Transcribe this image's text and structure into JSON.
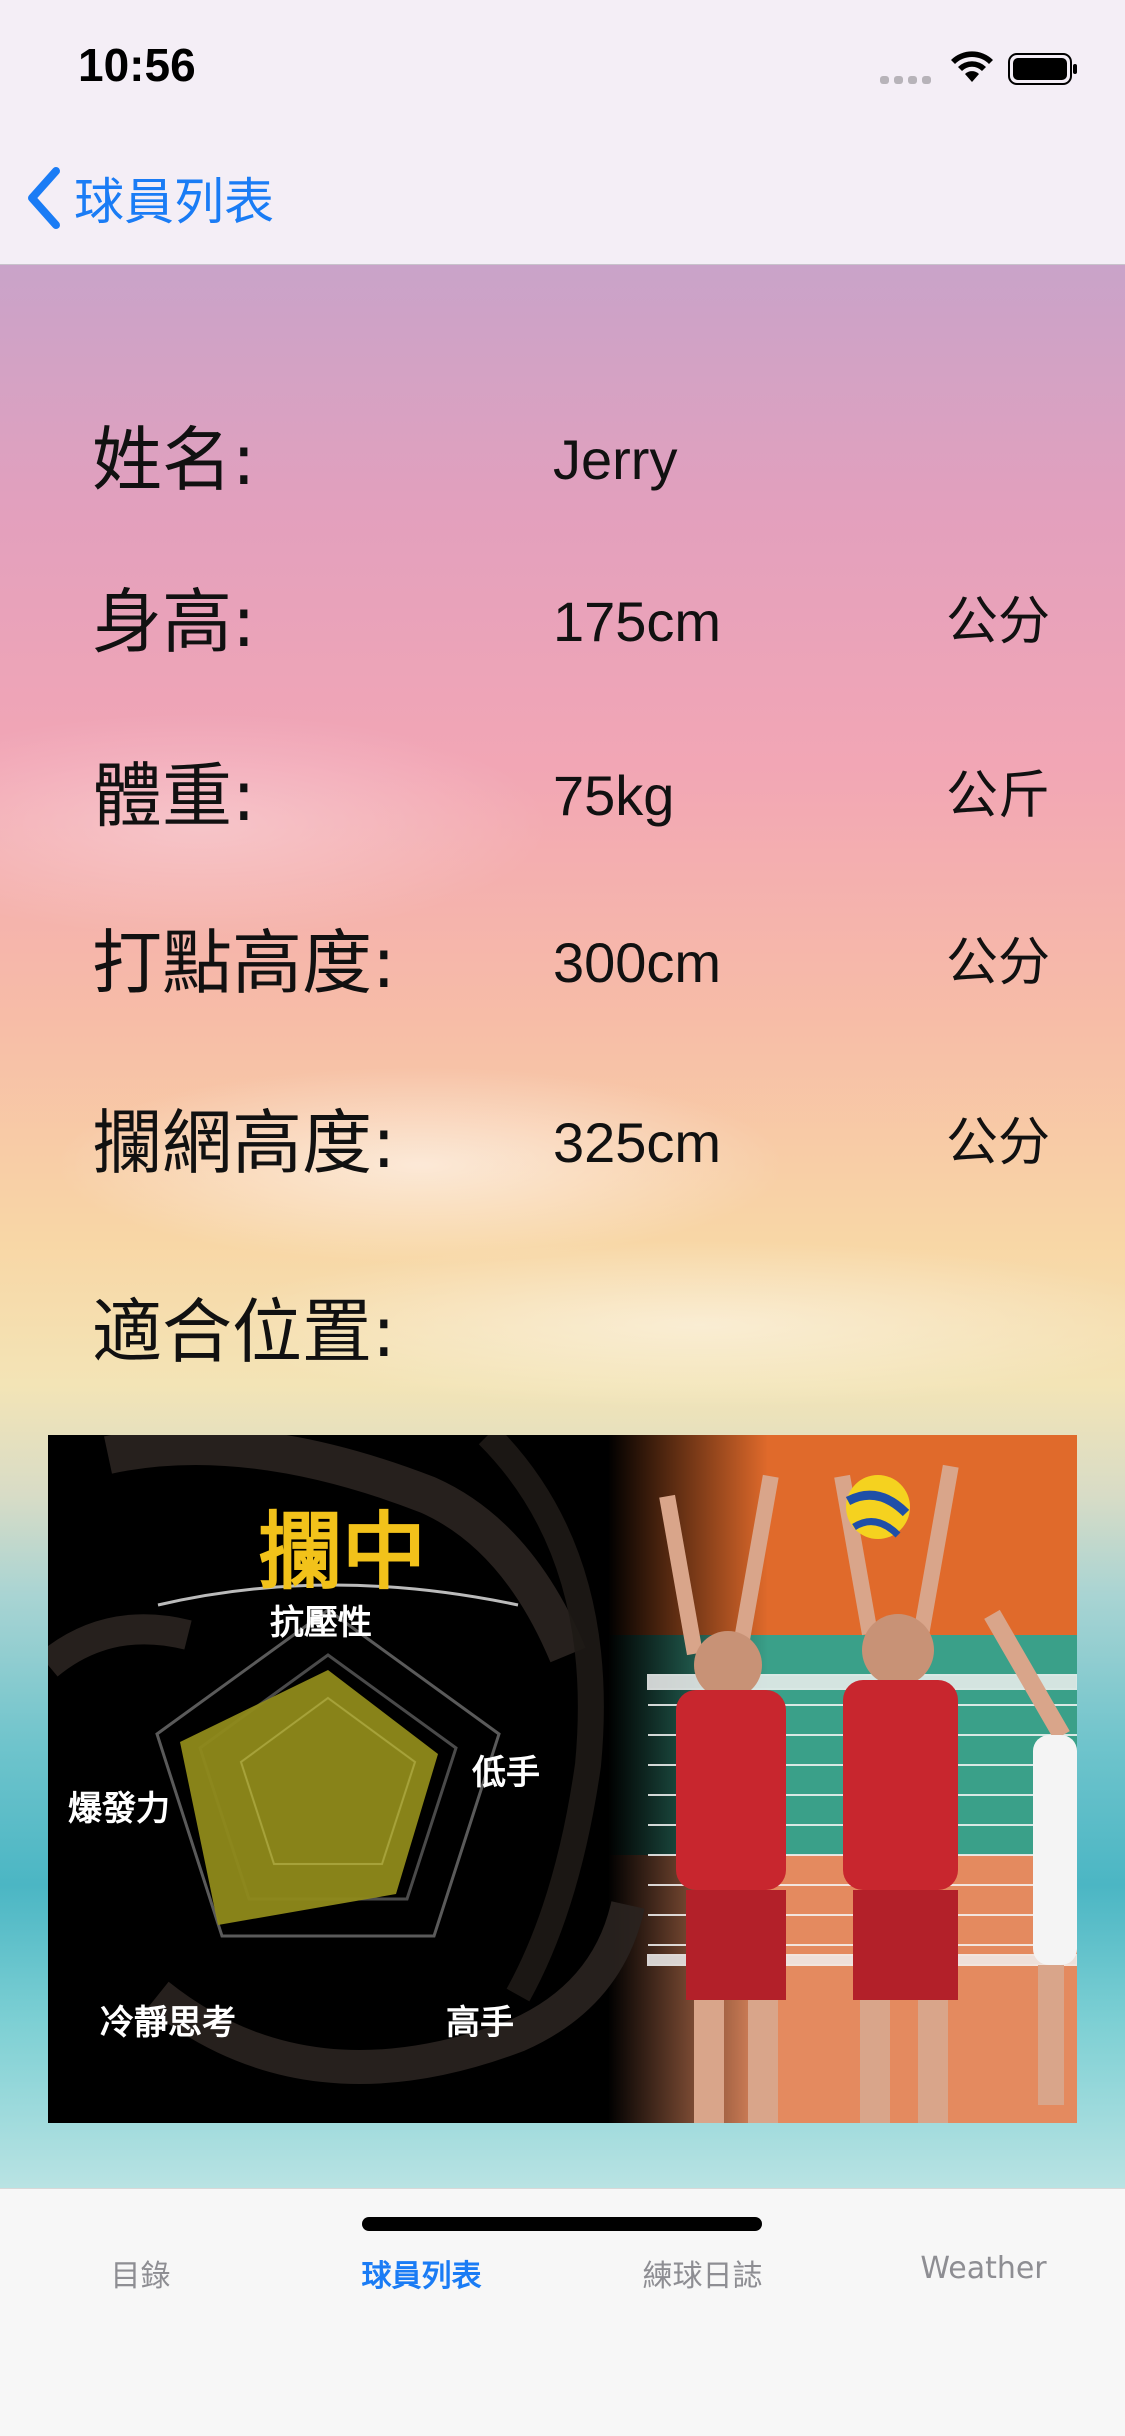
{
  "status_bar": {
    "time": "10:56"
  },
  "nav": {
    "back_label": "球員列表"
  },
  "player": {
    "fields": [
      {
        "label": "姓名:",
        "value": "Jerry",
        "unit": ""
      },
      {
        "label": "身高:",
        "value": "175cm",
        "unit": "公分"
      },
      {
        "label": "體重:",
        "value": "75kg",
        "unit": "公斤"
      },
      {
        "label": "打點高度:",
        "value": "300cm",
        "unit": "公分"
      },
      {
        "label": "攔網高度:",
        "value": "325cm",
        "unit": "公分"
      },
      {
        "label": "適合位置:",
        "value": "",
        "unit": ""
      }
    ]
  },
  "position_card": {
    "title": "攔中",
    "radar_axes": [
      "抗壓性",
      "低手",
      "高手",
      "冷靜思考",
      "爆發力"
    ]
  },
  "tab_bar": {
    "items": [
      {
        "label": "目錄",
        "active": false
      },
      {
        "label": "球員列表",
        "active": true
      },
      {
        "label": "練球日誌",
        "active": false
      },
      {
        "label": "Weather",
        "active": false
      }
    ]
  },
  "colors": {
    "accent": "#1a7cf5",
    "radar_fill": "#8f8a1a",
    "title_gold": "#f2c21a"
  }
}
